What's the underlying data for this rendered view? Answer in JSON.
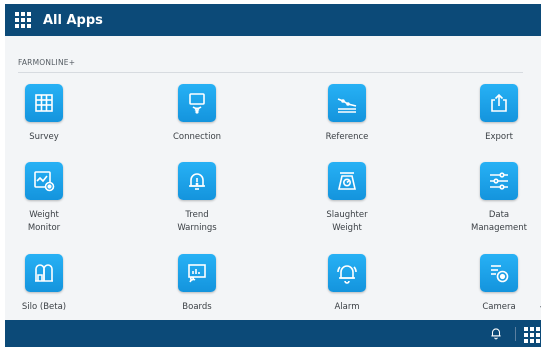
{
  "header": {
    "title": "All Apps",
    "icon": "apps-grid-icon"
  },
  "section": {
    "label": "FARMONLINE+"
  },
  "tiles": [
    {
      "label": "Survey",
      "icon": "survey-icon"
    },
    {
      "label": "Connection",
      "icon": "connection-icon"
    },
    {
      "label": "Reference",
      "icon": "reference-icon"
    },
    {
      "label": "Export",
      "icon": "export-icon"
    },
    {
      "label": "Weight\nMonitor",
      "icon": "weight-monitor-icon"
    },
    {
      "label": "Trend\nWarnings",
      "icon": "trend-warnings-icon"
    },
    {
      "label": "Slaughter\nWeight",
      "icon": "slaughter-weight-icon"
    },
    {
      "label": "Data\nManagement",
      "icon": "data-management-icon"
    },
    {
      "label": "Silo (Beta)",
      "icon": "silo-icon"
    },
    {
      "label": "Boards",
      "icon": "boards-icon"
    },
    {
      "label": "Alarm",
      "icon": "alarm-icon"
    },
    {
      "label": "Camera",
      "icon": "camera-icon"
    }
  ],
  "footer": {
    "icons": [
      "bell-icon",
      "apps-grid-icon"
    ]
  },
  "colors": {
    "header": "#0c4a78",
    "tile": "#1ea3ec",
    "background": "#f3f5f7"
  }
}
